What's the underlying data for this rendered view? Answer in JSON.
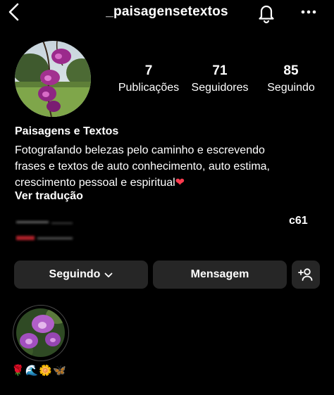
{
  "header": {
    "username": "_paisagensetextos",
    "back_icon": "chevron-left-icon",
    "notification_icon": "bell-icon",
    "more_icon": "more-horizontal-icon"
  },
  "profile": {
    "stats": [
      {
        "value": "7",
        "label": "Publicações"
      },
      {
        "value": "71",
        "label": "Seguidores"
      },
      {
        "value": "85",
        "label": "Seguindo"
      }
    ]
  },
  "bio": {
    "name": "Paisagens e Textos",
    "line1": "Fotografando belezas pelo caminho e escrevendo",
    "line2": "frases e textos de auto conhecimento, auto estima,",
    "line3": "crescimento pessoal e espiritual",
    "line3_emoji": "❤",
    "translate": "Ver tradução",
    "code": "c61"
  },
  "actions": {
    "following_label": "Seguindo",
    "message_label": "Mensagem",
    "add_user_icon": "add-user-icon"
  },
  "highlights": [
    {
      "label": "🌹🌊🌼🦋"
    }
  ],
  "colors": {
    "background": "#000000",
    "button_bg": "#262626",
    "heart": "#ff3b4e"
  }
}
